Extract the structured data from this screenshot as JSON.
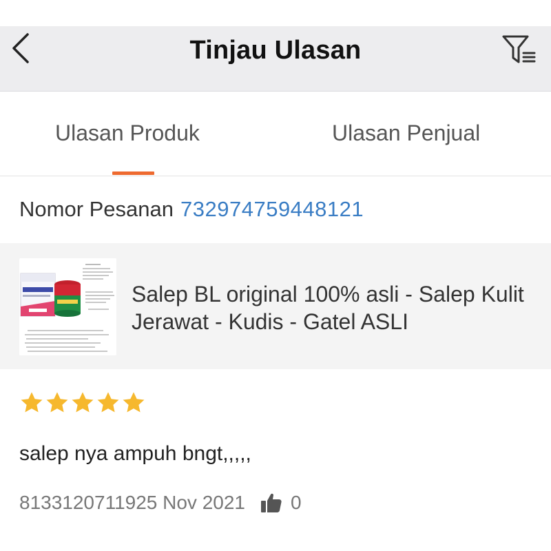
{
  "header": {
    "title": "Tinjau Ulasan",
    "back_icon": "chevron-left-icon",
    "filter_icon": "filter-icon"
  },
  "tabs": [
    {
      "label": "Ulasan Produk",
      "active": true
    },
    {
      "label": "Ulasan Penjual",
      "active": false
    }
  ],
  "order": {
    "label": "Nomor Pesanan",
    "number": "732974759448121"
  },
  "product": {
    "name": "Salep BL original 100% asli - Salep Kulit Jerawat - Kudis - Gatel ASLI"
  },
  "review": {
    "rating": 5,
    "max_rating": 5,
    "text": "salep nya ampuh bngt,,,,,",
    "meta": "8133120711925 Nov 2021",
    "likes": "0"
  },
  "colors": {
    "accent": "#ee6a2f",
    "link": "#3a7dc4",
    "star": "#f6b82e",
    "header_bg": "#ededef"
  }
}
